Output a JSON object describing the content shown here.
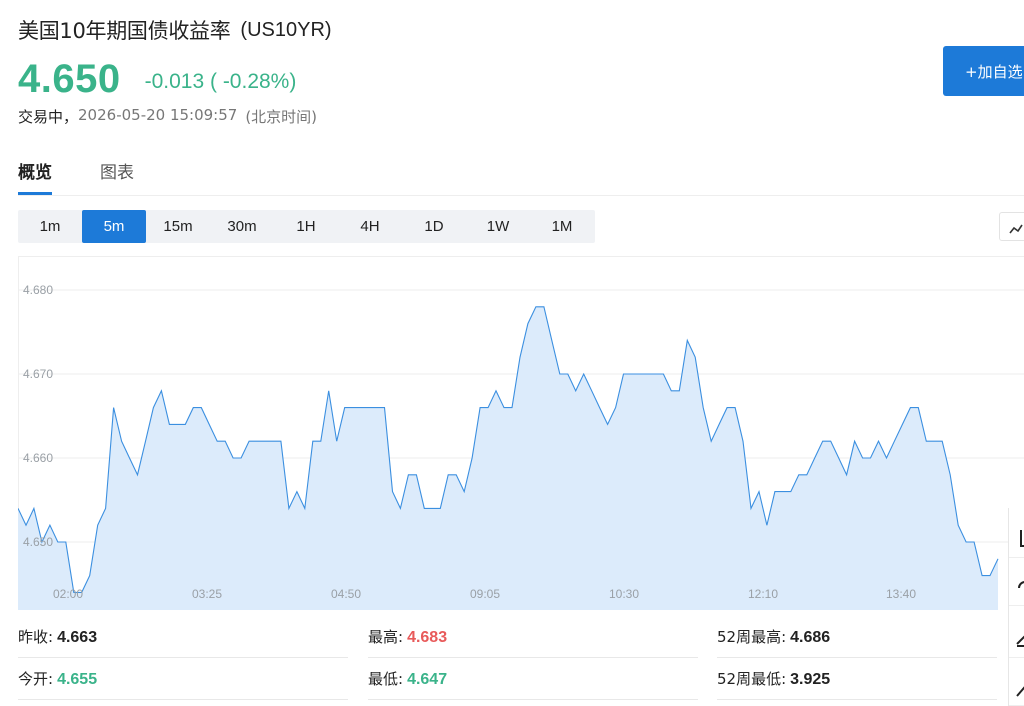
{
  "header": {
    "title_cn": "美国10年期国债收益率",
    "title_code": "(US10YR)",
    "price": "4.650",
    "change": "-0.013 ( -0.28%)",
    "status_label": "交易中，",
    "status_time": "2026-05-20 15:09:57",
    "status_tz": "(北京时间)",
    "add_watchlist": "+加自选"
  },
  "colors": {
    "down": "#3ab38a",
    "up": "#e85a5a",
    "accent": "#1d7ad8",
    "line": "#3b8fe0",
    "fill": "#dcebfb"
  },
  "tabs": [
    {
      "label": "概览",
      "active": true
    },
    {
      "label": "图表",
      "active": false
    }
  ],
  "intervals": [
    {
      "label": "1m",
      "active": false
    },
    {
      "label": "5m",
      "active": true
    },
    {
      "label": "15m",
      "active": false
    },
    {
      "label": "30m",
      "active": false
    },
    {
      "label": "1H",
      "active": false
    },
    {
      "label": "4H",
      "active": false
    },
    {
      "label": "1D",
      "active": false
    },
    {
      "label": "1W",
      "active": false
    },
    {
      "label": "1M",
      "active": false
    }
  ],
  "icons": {
    "chart_type": "line-chart-icon",
    "side_tools": [
      "fullscreen-icon",
      "undo-icon",
      "pencil-icon",
      "trendline-icon"
    ]
  },
  "chart_data": {
    "type": "area",
    "x_ticks": [
      "02:00",
      "03:25",
      "04:50",
      "09:05",
      "10:30",
      "12:10",
      "13:40"
    ],
    "y_ticks": [
      "4.680",
      "4.670",
      "4.660",
      "4.650"
    ],
    "ylim": [
      4.644,
      4.684
    ],
    "grid": true,
    "legend": "none",
    "series": [
      {
        "values": [
          4.654,
          4.652,
          4.654,
          4.65,
          4.652,
          4.65,
          4.65,
          4.644,
          4.644,
          4.646,
          4.652,
          4.654,
          4.666,
          4.662,
          4.66,
          4.658,
          4.662,
          4.666,
          4.668,
          4.664,
          4.664,
          4.664,
          4.666,
          4.666,
          4.664,
          4.662,
          4.662,
          4.66,
          4.66,
          4.662,
          4.662,
          4.662,
          4.662,
          4.662,
          4.654,
          4.656,
          4.654,
          4.662,
          4.662,
          4.668,
          4.662,
          4.666,
          4.666,
          4.666,
          4.666,
          4.666,
          4.666,
          4.656,
          4.654,
          4.658,
          4.658,
          4.654,
          4.654,
          4.654,
          4.658,
          4.658,
          4.656,
          4.66,
          4.666,
          4.666,
          4.668,
          4.666,
          4.666,
          4.672,
          4.676,
          4.678,
          4.678,
          4.674,
          4.67,
          4.67,
          4.668,
          4.67,
          4.668,
          4.666,
          4.664,
          4.666,
          4.67,
          4.67,
          4.67,
          4.67,
          4.67,
          4.67,
          4.668,
          4.668,
          4.674,
          4.672,
          4.666,
          4.662,
          4.664,
          4.666,
          4.666,
          4.662,
          4.654,
          4.656,
          4.652,
          4.656,
          4.656,
          4.656,
          4.658,
          4.658,
          4.66,
          4.662,
          4.662,
          4.66,
          4.658,
          4.662,
          4.66,
          4.66,
          4.662,
          4.66,
          4.662,
          4.664,
          4.666,
          4.666,
          4.662,
          4.662,
          4.662,
          4.658,
          4.652,
          4.65,
          4.65,
          4.646,
          4.646,
          4.648
        ]
      }
    ]
  },
  "stats": {
    "prev_close_label": "昨收:",
    "prev_close": "4.663",
    "open_label": "今开:",
    "open": "4.655",
    "high_label": "最高:",
    "high": "4.683",
    "low_label": "最低:",
    "low": "4.647",
    "w52_high_label": "52周最高:",
    "w52_high": "4.686",
    "w52_low_label": "52周最低:",
    "w52_low": "3.925"
  }
}
